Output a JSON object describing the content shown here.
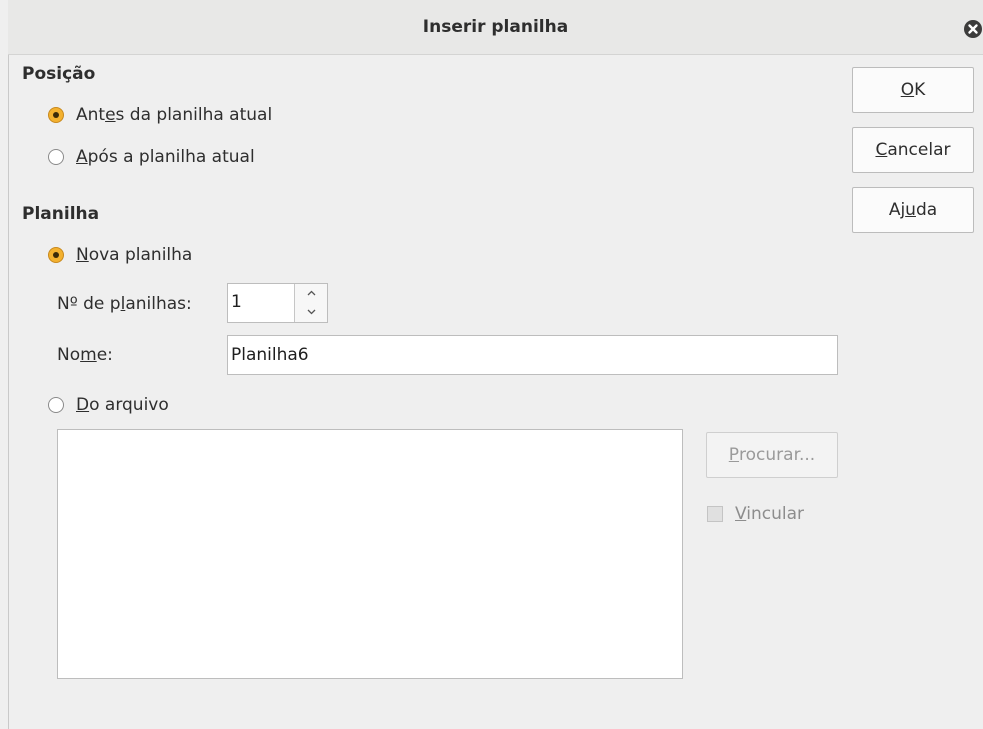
{
  "window": {
    "title": "Inserir planilha"
  },
  "position_section": {
    "heading": "Posição",
    "options": [
      {
        "before": "Ant",
        "mnemonic": "e",
        "after": "s da planilha atual",
        "checked": true
      },
      {
        "before": "",
        "mnemonic": "A",
        "after": "pós a planilha atual",
        "checked": false
      }
    ]
  },
  "sheet_section": {
    "heading": "Planilha",
    "new_sheet": {
      "before": "",
      "mnemonic": "N",
      "after": "ova planilha",
      "checked": true
    },
    "count_label": {
      "before": "Nº de p",
      "mnemonic": "l",
      "after": "anilhas:"
    },
    "count_value": "1",
    "name_label": {
      "before": "No",
      "mnemonic": "m",
      "after": "e:"
    },
    "name_value": "Planilha6",
    "from_file": {
      "before": "",
      "mnemonic": "D",
      "after": "o arquivo",
      "checked": false
    }
  },
  "file_controls": {
    "browse": {
      "before": "",
      "mnemonic": "P",
      "after": "rocurar..."
    },
    "link": {
      "before": "",
      "mnemonic": "V",
      "after": "incular",
      "checked": false
    }
  },
  "buttons": {
    "ok": {
      "before": "",
      "mnemonic": "O",
      "after": "K"
    },
    "cancel": {
      "before": "",
      "mnemonic": "C",
      "after": "ancelar"
    },
    "help": {
      "before": "Aj",
      "mnemonic": "u",
      "after": "da"
    }
  },
  "icons": {
    "close": "close-icon",
    "spin_up": "chevron-up-icon",
    "spin_down": "chevron-down-icon"
  },
  "colors": {
    "accent_radio": "#f3b12f",
    "dialog_bg": "#efefef"
  }
}
